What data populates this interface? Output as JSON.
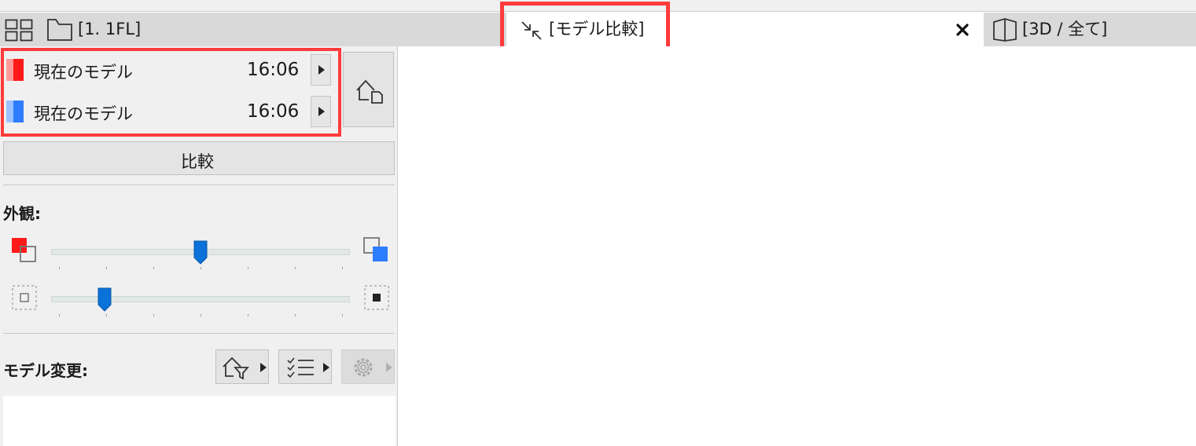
{
  "tabs": {
    "floor_plan": "[1. 1FL]",
    "compare": "[モデル比較]",
    "view3d": "[3D / 全て]"
  },
  "models": [
    {
      "name": "現在のモデル",
      "time": "16:06",
      "color": "#ff1a1a",
      "light": "#ff9a9a"
    },
    {
      "name": "現在のモデル",
      "time": "16:06",
      "color": "#2e7dff",
      "light": "#9cc1ff"
    }
  ],
  "compare_button": "比較",
  "appearance": {
    "title": "外観:",
    "slider1_value": 0.5,
    "slider2_value": 0.18
  },
  "model_changes": {
    "title": "モデル変更:"
  },
  "colors": {
    "accent": "#0a72d8",
    "highlight": "#ff3b3b",
    "tabbar": "#d9d9d9"
  }
}
